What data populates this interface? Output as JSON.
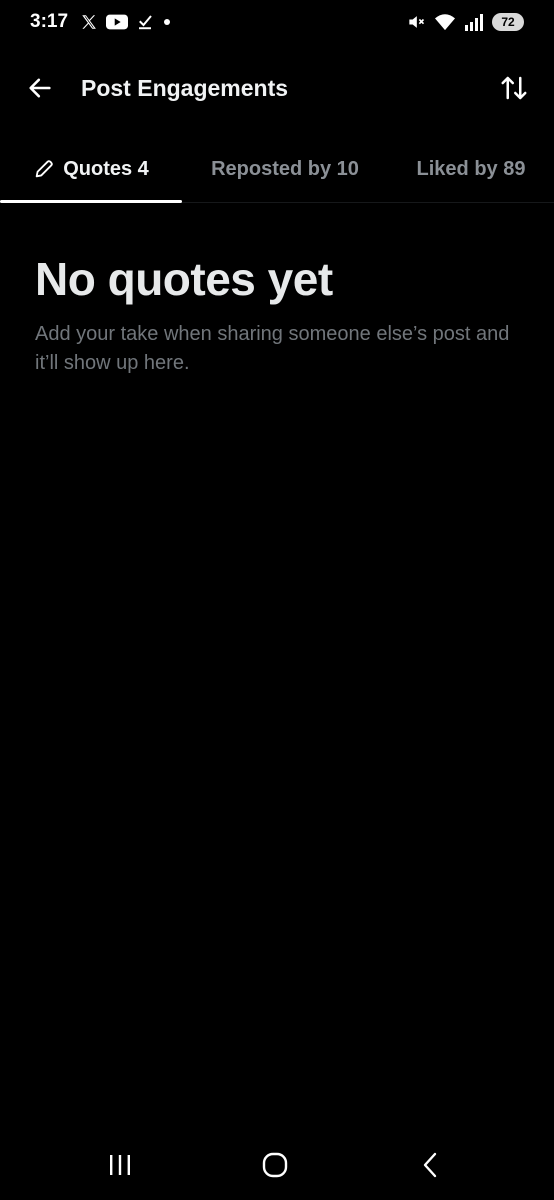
{
  "status_bar": {
    "time": "3:17",
    "battery": "72",
    "icons_left": [
      "x-logo-icon",
      "youtube-icon",
      "download-done-icon",
      "dot-icon"
    ],
    "icons_right": [
      "mute-icon",
      "wifi-icon",
      "signal-icon",
      "battery-icon"
    ]
  },
  "header": {
    "title": "Post Engagements",
    "back_icon": "arrow-left-icon",
    "sort_icon": "sort-arrows-icon"
  },
  "tabs": [
    {
      "label": "Quotes 4",
      "active": true,
      "icon": "pencil-icon"
    },
    {
      "label": "Reposted by 10",
      "active": false
    },
    {
      "label": "Liked by 89",
      "active": false
    }
  ],
  "empty_state": {
    "title": "No quotes yet",
    "subtitle": "Add your take when sharing someone else’s post and it’ll show up here."
  },
  "nav_bar": {
    "icons": [
      "recents-icon",
      "home-icon",
      "back-icon"
    ]
  },
  "colors": {
    "background": "#000000",
    "text_primary": "#e7e9ea",
    "text_secondary": "#71767b",
    "tab_inactive": "#8b9096",
    "underline": "#ffffff"
  }
}
